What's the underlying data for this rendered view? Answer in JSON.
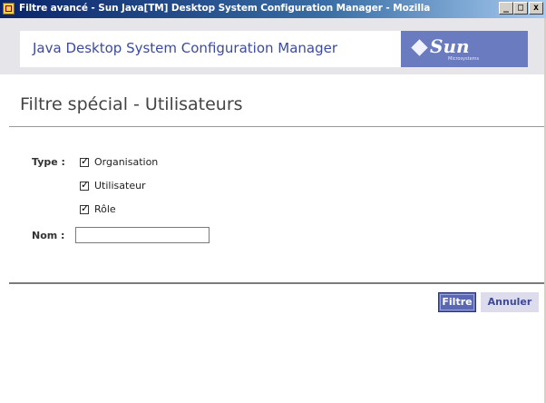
{
  "window": {
    "title": "Filtre avancé - Sun Java[TM] Desktop System Configuration Manager - Mozilla",
    "controls": {
      "minimize": "_",
      "maximize": "□",
      "close": "x"
    }
  },
  "header": {
    "app_name": "Java Desktop System Configuration Manager",
    "logo_text": "Sun",
    "logo_subtext": "Microsystems"
  },
  "page": {
    "title": "Filtre spécial - Utilisateurs"
  },
  "form": {
    "type_label": "Type :",
    "options": [
      {
        "label": "Organisation",
        "checked": true
      },
      {
        "label": "Utilisateur",
        "checked": true
      },
      {
        "label": "Rôle",
        "checked": true
      }
    ],
    "name_label": "Nom :",
    "name_value": ""
  },
  "actions": {
    "filter_label": "Filtre",
    "cancel_label": "Annuler"
  },
  "colors": {
    "brand_text": "#3b4aa0",
    "primary_button": "#5a68b4",
    "secondary_button": "#dcdcec"
  }
}
